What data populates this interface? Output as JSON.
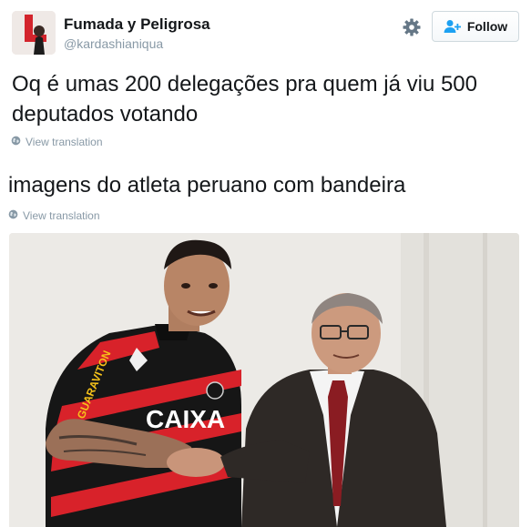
{
  "tweet": {
    "display_name": "Fumada y Peligrosa",
    "handle": "@kardashianiqua",
    "follow_label": "Follow",
    "text": "Oq é umas 200 delegações pra quem já viu 500 deputados votando",
    "view_translation": "View translation"
  },
  "quoted": {
    "text": "imagens do atleta peruano com bandeira",
    "view_translation": "View translation",
    "jersey_sponsor_1": "GUARAVITON",
    "jersey_sponsor_2": "CAIXA"
  },
  "icons": {
    "gear": "gear-icon",
    "follow": "person-plus-icon",
    "globe": "globe-icon"
  },
  "colors": {
    "accent": "#1da1f2",
    "muted": "#8899a6",
    "text": "#14171a"
  }
}
